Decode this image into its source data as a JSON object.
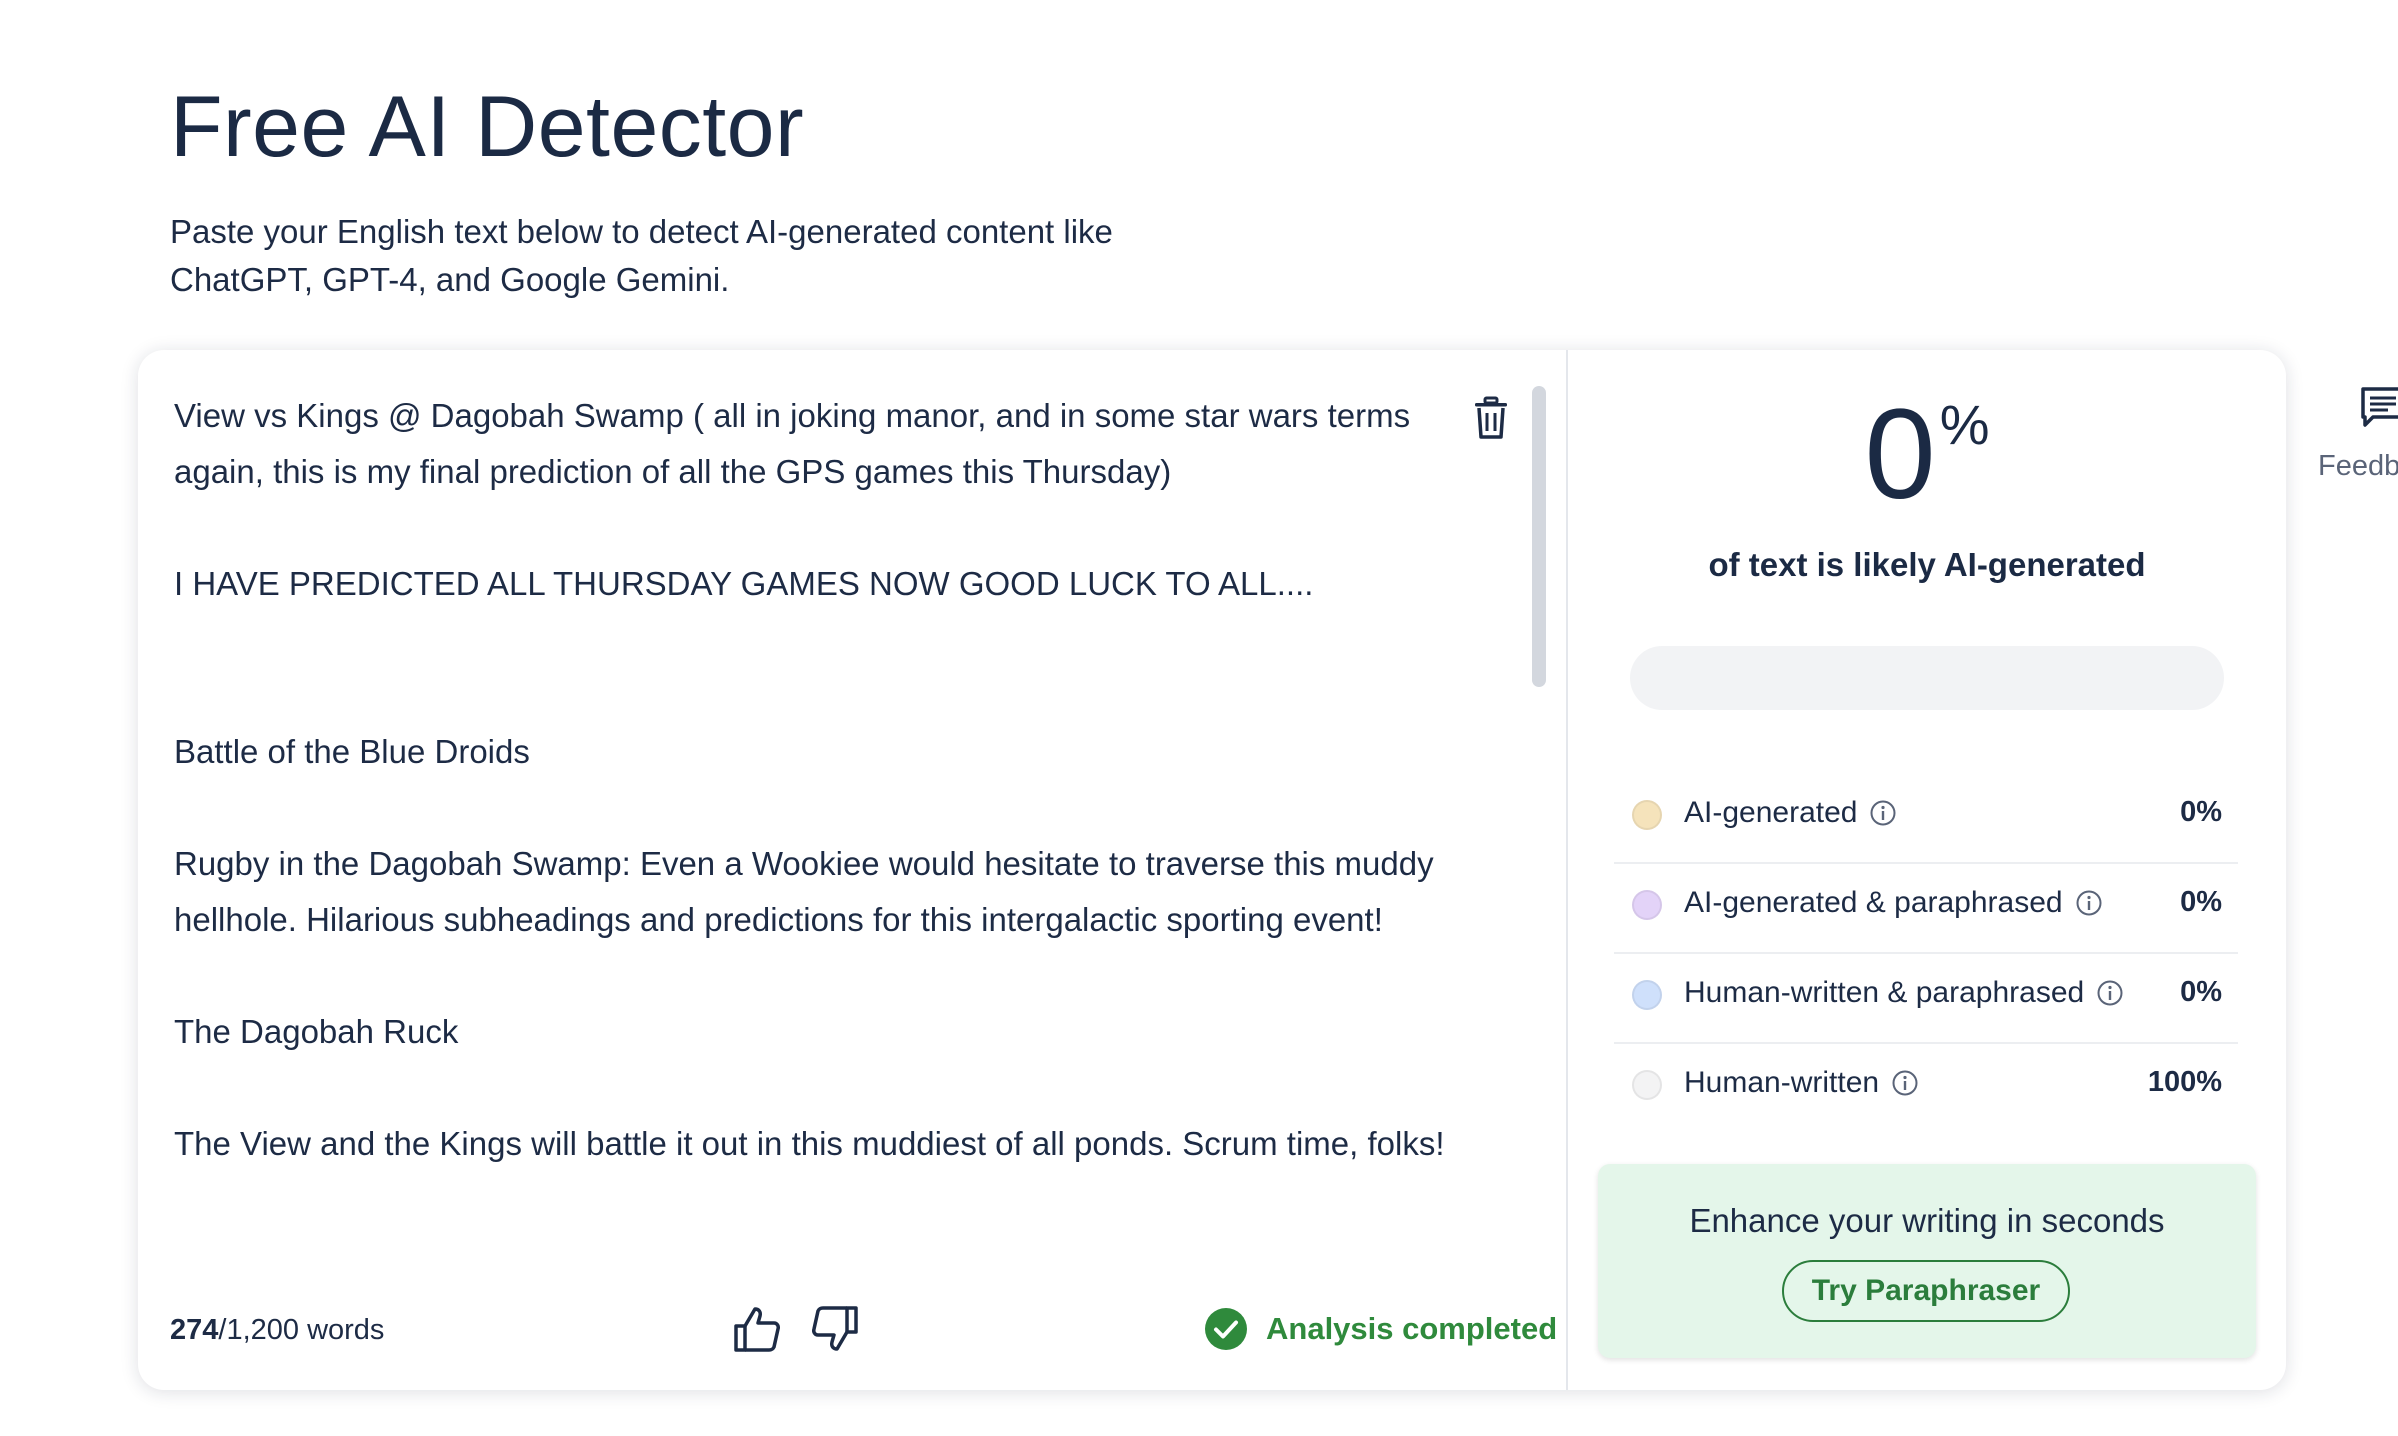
{
  "header": {
    "title": "Free AI Detector",
    "subtitle_line1": "Paste your English text below to detect AI-generated content like",
    "subtitle_line2": "ChatGPT, GPT-4, and Google Gemini."
  },
  "editor": {
    "paragraphs": [
      "View vs Kings @ Dagobah Swamp ( all in joking manor, and in some star wars terms again, this is my final prediction of all the GPS games this Thursday)",
      "I HAVE PREDICTED ALL THURSDAY GAMES NOW GOOD LUCK TO ALL....",
      "Battle of the Blue Droids",
      "Rugby in the Dagobah Swamp: Even a Wookiee would hesitate to traverse this muddy hellhole. Hilarious subheadings and predictions for this intergalactic sporting event!",
      "The Dagobah Ruck",
      "The View and the Kings will battle it out in this muddiest of all ponds. Scrum time, folks!"
    ],
    "word_count_current": "274",
    "word_count_limit": "/1,200 words",
    "status_text": "Analysis completed",
    "status_color": "#2f8a3c",
    "scroll_fraction_visible": 0.35,
    "icons": {
      "clear": "trash-icon",
      "like": "thumbs-up-icon",
      "dislike": "thumbs-down-icon",
      "status": "check-circle-icon"
    }
  },
  "results": {
    "percent_value": "0",
    "percent_unit": "%",
    "caption": "of text is likely AI-generated",
    "ai_fraction": 0.0,
    "legend": [
      {
        "label": "AI-generated",
        "value": "0%",
        "color": "#f5e3bb"
      },
      {
        "label": "AI-generated & paraphrased",
        "value": "0%",
        "color": "#e3d3f8"
      },
      {
        "label": "Human-written & paraphrased",
        "value": "0%",
        "color": "#cfe0fb"
      },
      {
        "label": "Human-written",
        "value": "100%",
        "color": "#f3f3f4"
      }
    ],
    "promo_text": "Enhance your writing in seconds",
    "promo_button": "Try Paraphraser"
  },
  "side": {
    "feedback_label": "Feedb",
    "feedback_icon": "message-icon"
  }
}
